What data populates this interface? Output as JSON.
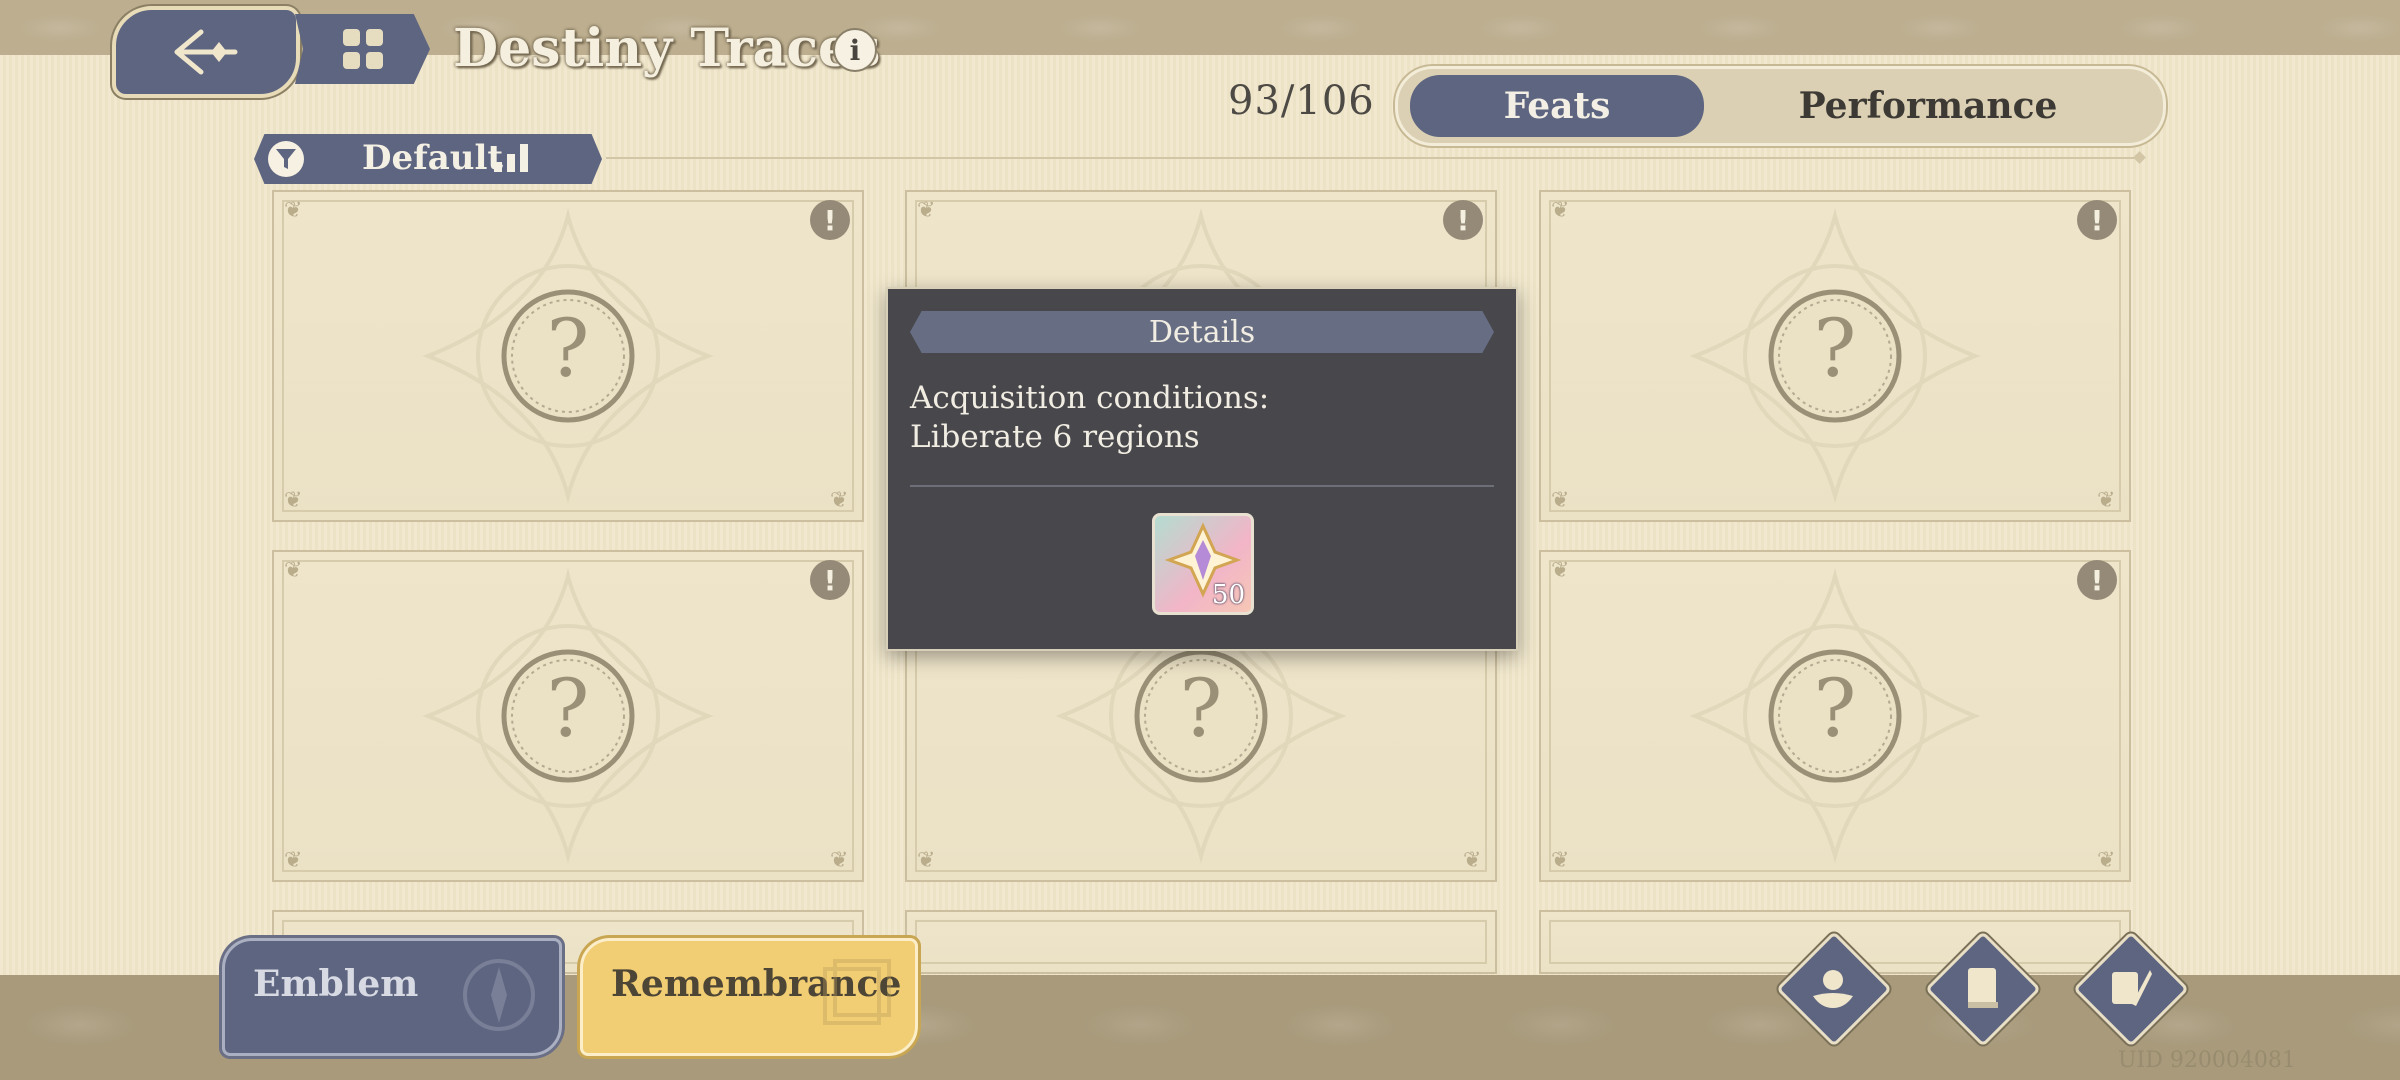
{
  "header": {
    "title": "Destiny Traces",
    "info_label": "i",
    "progress": "93/106"
  },
  "tabs": [
    {
      "label": "Feats",
      "active": true
    },
    {
      "label": "Performance",
      "active": false
    }
  ],
  "filter": {
    "label": "Default"
  },
  "cards": [
    {
      "symbol": "?",
      "alert": "!"
    },
    {
      "symbol": "?",
      "alert": "!"
    },
    {
      "symbol": "?",
      "alert": "!"
    },
    {
      "symbol": "?",
      "alert": "!"
    },
    {
      "symbol": "?",
      "alert": "!"
    },
    {
      "symbol": "?",
      "alert": "!"
    }
  ],
  "popup": {
    "title": "Details",
    "condition_line1": "Acquisition conditions:",
    "condition_line2": "Liberate 6 regions",
    "reward_quantity": "50",
    "reward_icon": "crystal-icon"
  },
  "bottom": {
    "emblem_label": "Emblem",
    "remembrance_label": "Remembrance",
    "icons": [
      "flower-hand-icon",
      "book-icon",
      "scroll-quill-icon"
    ],
    "uid": "UID 920004081"
  },
  "colors": {
    "accent_slate": "#5e6581",
    "accent_gold": "#f1cd73",
    "paper": "#efe6cc",
    "popup_bg": "#47474c"
  }
}
